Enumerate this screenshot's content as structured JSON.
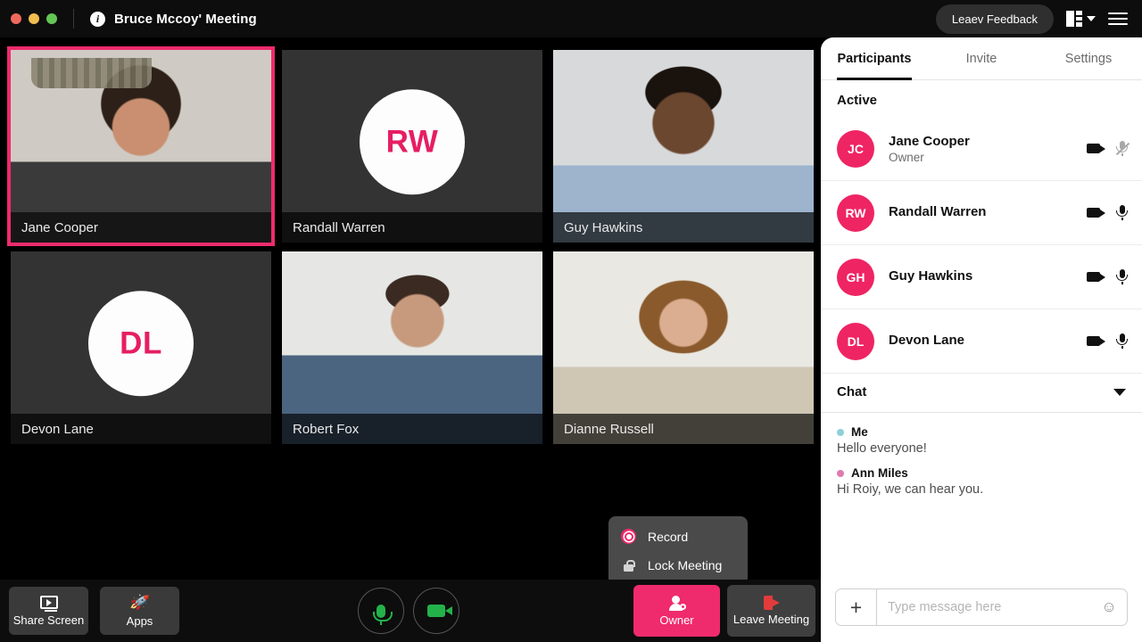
{
  "titlebar": {
    "title": "Bruce Mccoy' Meeting",
    "info_icon": "info-icon",
    "feedback_label": "Leaev Feedback",
    "layout_icon": "layout-grid-icon",
    "menu_icon": "hamburger-menu-icon"
  },
  "tiles": [
    {
      "name": "Jane Cooper",
      "initials": "",
      "type": "video",
      "active": true,
      "photo": "jane"
    },
    {
      "name": "Randall Warren",
      "initials": "RW",
      "type": "avatar",
      "active": false,
      "photo": ""
    },
    {
      "name": "Guy Hawkins",
      "initials": "",
      "type": "video",
      "active": false,
      "photo": "guy"
    },
    {
      "name": "Devon Lane",
      "initials": "DL",
      "type": "avatar",
      "active": false,
      "photo": ""
    },
    {
      "name": "Robert Fox",
      "initials": "",
      "type": "video",
      "active": false,
      "photo": "robert"
    },
    {
      "name": "Dianne Russell",
      "initials": "",
      "type": "video",
      "active": false,
      "photo": "dianne"
    }
  ],
  "context_menu": {
    "items": [
      {
        "label": "Record",
        "icon": "record-icon"
      },
      {
        "label": "Lock Meeting",
        "icon": "lock-icon"
      }
    ]
  },
  "toolbar": {
    "share_screen_label": "Share Screen",
    "apps_label": "Apps",
    "mic_icon": "microphone-icon",
    "camera_icon": "camera-icon",
    "owner_label": "Owner",
    "leave_label": "Leave Meeting"
  },
  "sidebar": {
    "tabs": [
      {
        "label": "Participants",
        "active": true
      },
      {
        "label": "Invite",
        "active": false
      },
      {
        "label": "Settings",
        "active": false
      }
    ],
    "section_title": "Active",
    "participants": [
      {
        "initials": "JC",
        "name": "Jane Cooper",
        "role": "Owner",
        "camera_on": true,
        "mic_muted": true
      },
      {
        "initials": "RW",
        "name": "Randall Warren",
        "role": "",
        "camera_on": true,
        "mic_muted": false
      },
      {
        "initials": "GH",
        "name": "Guy Hawkins",
        "role": "",
        "camera_on": true,
        "mic_muted": false
      },
      {
        "initials": "DL",
        "name": "Devon Lane",
        "role": "",
        "camera_on": true,
        "mic_muted": false
      }
    ],
    "chat": {
      "title": "Chat",
      "collapse_icon": "chevron-down-icon",
      "messages": [
        {
          "author": "Me",
          "dot_color": "#8ecfd8",
          "text": "Hello everyone!"
        },
        {
          "author": "Ann Miles",
          "dot_color": "#e07ab0",
          "text": "Hi Roiy, we can hear you."
        }
      ],
      "composer": {
        "add_label": "+",
        "placeholder": "Type message here",
        "value": "",
        "emoji_icon": "emoji-smiley-icon"
      }
    }
  },
  "colors": {
    "accent_pink": "#ef2b6d",
    "avatar_pink": "#ef2463",
    "mic_green": "#23b24a",
    "leave_red": "#e23b3b",
    "stage_bg": "#000000",
    "tile_bg": "#333333"
  }
}
